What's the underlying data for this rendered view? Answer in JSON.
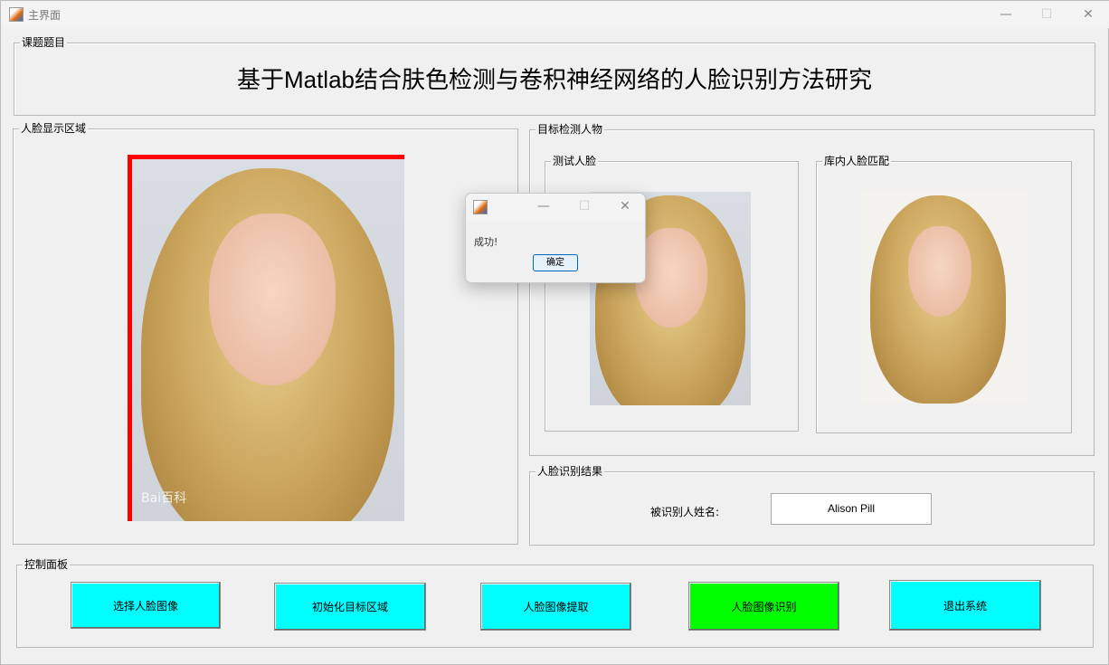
{
  "window": {
    "title": "主界面",
    "minimize": "—",
    "maximize": "☐",
    "close": "✕"
  },
  "title_panel": {
    "label": "课题题目",
    "heading": "基于Matlab结合肤色检测与卷积神经网络的人脸识别方法研究"
  },
  "face_display": {
    "label": "人脸显示区域",
    "watermark": "Bai百科"
  },
  "target_panel": {
    "label": "目标检测人物",
    "test_face": {
      "label": "测试人脸"
    },
    "library_face": {
      "label": "库内人脸匹配"
    }
  },
  "result_panel": {
    "label": "人脸识别结果",
    "name_label": "被识别人姓名:",
    "name_value": "Alison Pill"
  },
  "control_panel": {
    "label": "控制面板",
    "buttons": [
      {
        "label": "选择人脸图像",
        "color": "#00ffff"
      },
      {
        "label": "初始化目标区域",
        "color": "#00ffff"
      },
      {
        "label": "人脸图像提取",
        "color": "#00ffff"
      },
      {
        "label": "人脸图像识别",
        "color": "#00ff00"
      },
      {
        "label": "退出系统",
        "color": "#00ffff"
      }
    ]
  },
  "dialog": {
    "message": "成功!",
    "ok": "确定",
    "minimize": "—",
    "maximize": "☐",
    "close": "✕"
  }
}
